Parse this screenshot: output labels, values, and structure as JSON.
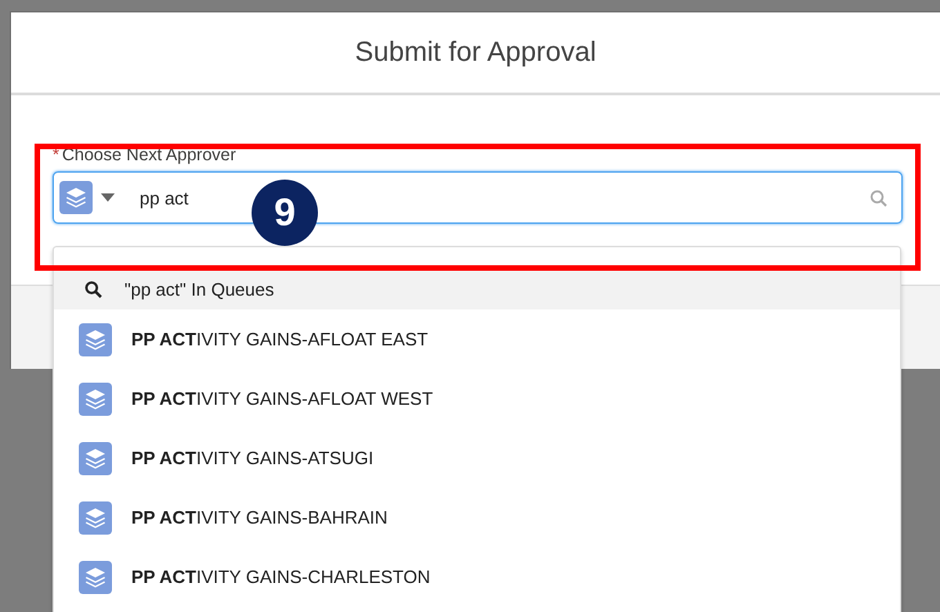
{
  "modal": {
    "title": "Submit for Approval"
  },
  "field": {
    "required_mark": "*",
    "label": "Choose Next Approver",
    "value": "pp act"
  },
  "dropdown": {
    "search_row": "\"pp act\" In Queues",
    "items": [
      {
        "text": "**PP ACT**IVITY GAINS-AFLOAT EAST"
      },
      {
        "text": "**PP ACT**IVITY GAINS-AFLOAT WEST"
      },
      {
        "text": "**PP ACT**IVITY GAINS-ATSUGI"
      },
      {
        "text": "**PP ACT**IVITY GAINS-BAHRAIN"
      },
      {
        "text": "**PP ACT**IVITY GAINS-CHARLESTON"
      }
    ]
  },
  "annotation": {
    "step": "9"
  }
}
